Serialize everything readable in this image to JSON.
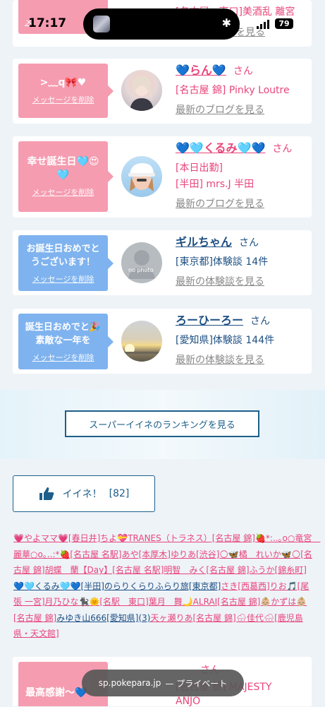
{
  "status_bar": {
    "time": "17:17",
    "battery": "79"
  },
  "top_partial": {
    "text": "[名古屋　東口]美酒乱 離宮",
    "link": "最新のブログを見る",
    "prefix": "メ"
  },
  "cards": [
    {
      "bubble_color": "pink",
      "message": ">﹏q🎀♥",
      "delete_label": "メッセージを削除",
      "name": "💙らん💙",
      "san": "さん",
      "lines": [
        "[名古屋 錦] Pinky Loutre"
      ],
      "link": "最新のブログを見る",
      "avatar": "woman-photo"
    },
    {
      "bubble_color": "pink",
      "message": "幸せ誕生日🩵😍🩵",
      "delete_label": "メッセージを削除",
      "name": "💙🩵くるみ🩵💙",
      "san": "さん",
      "lines": [
        "[本日出勤]",
        "[半田] mrs.J 半田"
      ],
      "link": "最新のブログを見る",
      "avatar": "woman-cap-photo"
    },
    {
      "bubble_color": "blue",
      "message": "お誕生日おめでとうございます！",
      "delete_label": "メッセージを削除",
      "name": "ギルちゃん",
      "san": "さん",
      "lines": [
        "[東京都]体験談 14件"
      ],
      "link": "最新の体験談を見る",
      "avatar": "no photo"
    },
    {
      "bubble_color": "blue",
      "message": "誕生日おめでと🎉素敵な一年を",
      "delete_label": "メッセージを削除",
      "name": "ろーひーろー",
      "san": "さん",
      "lines": [
        "[愛知県]体験談 144件"
      ],
      "link": "最新の体験談を見る",
      "avatar": "sunset-photo"
    }
  ],
  "ranking_button": "スーパーイイネのランキングを見る",
  "iine": {
    "label": "イイネ！",
    "count": "[82]"
  },
  "iine_names": [
    {
      "t": "💗やよママ💗[春日井]ちよ💝TRANES（トラネス）[名古屋 錦]",
      "c": "p"
    },
    {
      "t": "🍓*:..｡o○竜宮　麗華○o｡..:*🍓[名古屋 名駅]あや[本厚木]ゆりあ[渋谷]🌕🦋橘　れいか🦋🌕[名古屋 錦]胡蝶　蘭【Day】[名古屋 名駅]明智　みく[名古屋 錦]ふうか[錦糸町]",
      "c": "p"
    },
    {
      "t": "💙🩵くるみ🩵💙[半田]",
      "c": "b"
    },
    {
      "t": "のらりくらりふらり旅[東京都]",
      "c": "b"
    },
    {
      "t": "さき[西葛西]りお🎵[尾張 一宮]月乃ひな🐈‍⬛🌞[名駅　東口]葉月　舞🌙ALRAI[名古屋 錦]👶🏼かずは👶🏼[名古屋 錦]",
      "c": "p"
    },
    {
      "t": "みゆき山666[愛知県](3)",
      "c": "b"
    },
    {
      "t": "天ヶ瀬りあ[名古屋 錦]🌧佳代🌧[鹿児島県・天文館]",
      "c": "p"
    }
  ],
  "bottom_card": {
    "message": "最高感謝〜💙",
    "san": "さん",
    "line": "[名古屋 錦] MAJESTY",
    "line2": "ANJO"
  },
  "url_bar": {
    "domain": "sp.pokepara.jp",
    "mode": "— プライベート"
  }
}
